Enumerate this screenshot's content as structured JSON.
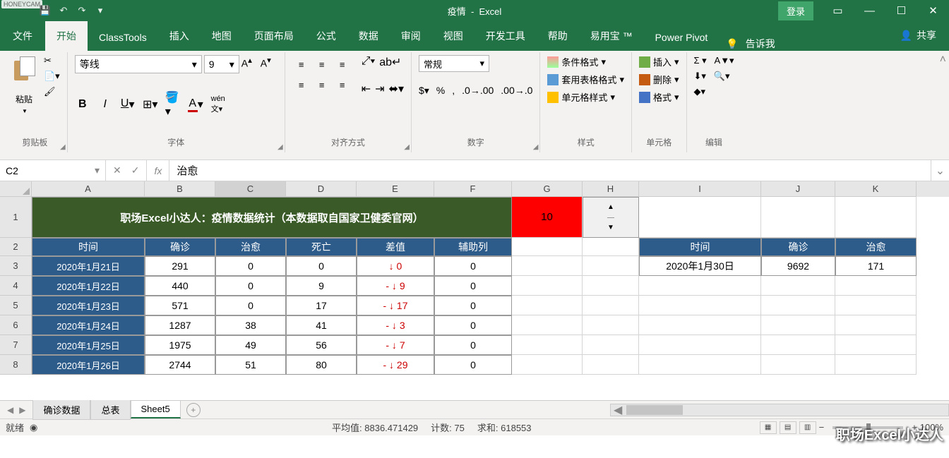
{
  "watermark": "HONEYCAM",
  "title": {
    "doc": "疫情",
    "app": "Excel"
  },
  "login": "登录",
  "tabs": [
    "文件",
    "开始",
    "ClassTools",
    "插入",
    "地图",
    "页面布局",
    "公式",
    "数据",
    "审阅",
    "视图",
    "开发工具",
    "帮助",
    "易用宝 ™",
    "Power Pivot"
  ],
  "active_tab": 1,
  "tell_me": "告诉我",
  "share": "共享",
  "ribbon": {
    "clipboard": {
      "label": "剪贴板",
      "paste": "粘贴"
    },
    "font": {
      "label": "字体",
      "name": "等线",
      "size": "9"
    },
    "alignment": {
      "label": "对齐方式"
    },
    "number": {
      "label": "数字",
      "format": "常规"
    },
    "styles": {
      "label": "样式",
      "cond": "条件格式",
      "table": "套用表格格式",
      "cell": "单元格样式"
    },
    "cells": {
      "label": "单元格",
      "insert": "插入",
      "delete": "删除",
      "format": "格式"
    },
    "editing": {
      "label": "编辑"
    }
  },
  "namebox": "C2",
  "formula": "治愈",
  "columns": [
    "A",
    "B",
    "C",
    "D",
    "E",
    "F",
    "G",
    "H",
    "I",
    "J",
    "K"
  ],
  "banner": "职场Excel小达人：疫情数据统计（本数据取自国家卫健委官网）",
  "spinner_value": "10",
  "headers_left": [
    "时间",
    "确诊",
    "治愈",
    "死亡",
    "差值",
    "辅助列"
  ],
  "rows_left": [
    {
      "date": "2020年1月21日",
      "confirmed": "291",
      "cured": "0",
      "death": "0",
      "diff": "↓ 0",
      "aux": "0"
    },
    {
      "date": "2020年1月22日",
      "confirmed": "440",
      "cured": "0",
      "death": "9",
      "diff": "- ↓ 9",
      "aux": "0"
    },
    {
      "date": "2020年1月23日",
      "confirmed": "571",
      "cured": "0",
      "death": "17",
      "diff": "- ↓ 17",
      "aux": "0"
    },
    {
      "date": "2020年1月24日",
      "confirmed": "1287",
      "cured": "38",
      "death": "41",
      "diff": "- ↓ 3",
      "aux": "0"
    },
    {
      "date": "2020年1月25日",
      "confirmed": "1975",
      "cured": "49",
      "death": "56",
      "diff": "- ↓ 7",
      "aux": "0"
    },
    {
      "date": "2020年1月26日",
      "confirmed": "2744",
      "cured": "51",
      "death": "80",
      "diff": "- ↓ 29",
      "aux": "0"
    }
  ],
  "headers_right": [
    "时间",
    "确诊",
    "治愈"
  ],
  "row_right": {
    "date": "2020年1月30日",
    "confirmed": "9692",
    "cured": "171"
  },
  "sheets": [
    "确诊数据",
    "总表",
    "Sheet5"
  ],
  "active_sheet": 2,
  "status": {
    "ready": "就绪",
    "avg_label": "平均值:",
    "avg": "8836.471429",
    "count_label": "计数:",
    "count": "75",
    "sum_label": "求和:",
    "sum": "618553",
    "zoom": "100%"
  },
  "brand": "职场Excel小达人"
}
